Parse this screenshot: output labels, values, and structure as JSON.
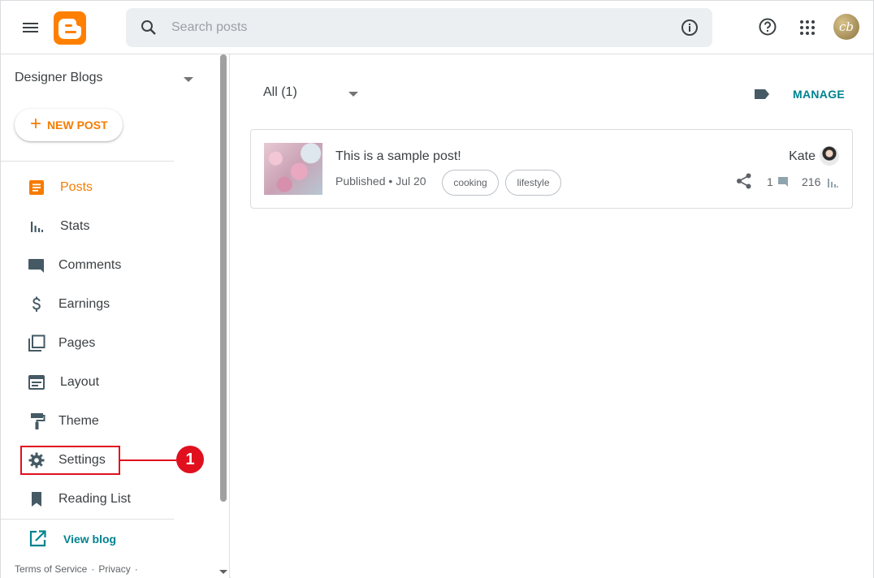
{
  "search": {
    "placeholder": "Search posts"
  },
  "sidebar": {
    "blog_name": "Designer Blogs",
    "new_post_label": "NEW POST",
    "items": [
      {
        "label": "Posts",
        "icon": "posts-icon",
        "active": true
      },
      {
        "label": "Stats",
        "icon": "stats-icon"
      },
      {
        "label": "Comments",
        "icon": "comment-icon"
      },
      {
        "label": "Earnings",
        "icon": "dollar-icon"
      },
      {
        "label": "Pages",
        "icon": "pages-icon"
      },
      {
        "label": "Layout",
        "icon": "layout-icon"
      },
      {
        "label": "Theme",
        "icon": "paint-roller-icon"
      },
      {
        "label": "Settings",
        "icon": "gear-icon"
      },
      {
        "label": "Reading List",
        "icon": "bookmark-icon"
      }
    ],
    "view_blog_label": "View blog",
    "footer": {
      "terms": "Terms of Service",
      "separator": "·",
      "privacy": "Privacy"
    }
  },
  "annotation": {
    "badge": "1"
  },
  "main": {
    "filter_label": "All (1)",
    "manage_label": "MANAGE",
    "posts": [
      {
        "title": "This is a sample post!",
        "status": "Published",
        "separator": "•",
        "date": "Jul 20",
        "labels": [
          "cooking",
          "lifestyle"
        ],
        "author": "Kate",
        "comments": "1",
        "views": "216"
      }
    ]
  },
  "colors": {
    "brand": "#ff8000",
    "accent": "#00838f",
    "active": "#f57c00",
    "annotation": "#e0101f"
  }
}
